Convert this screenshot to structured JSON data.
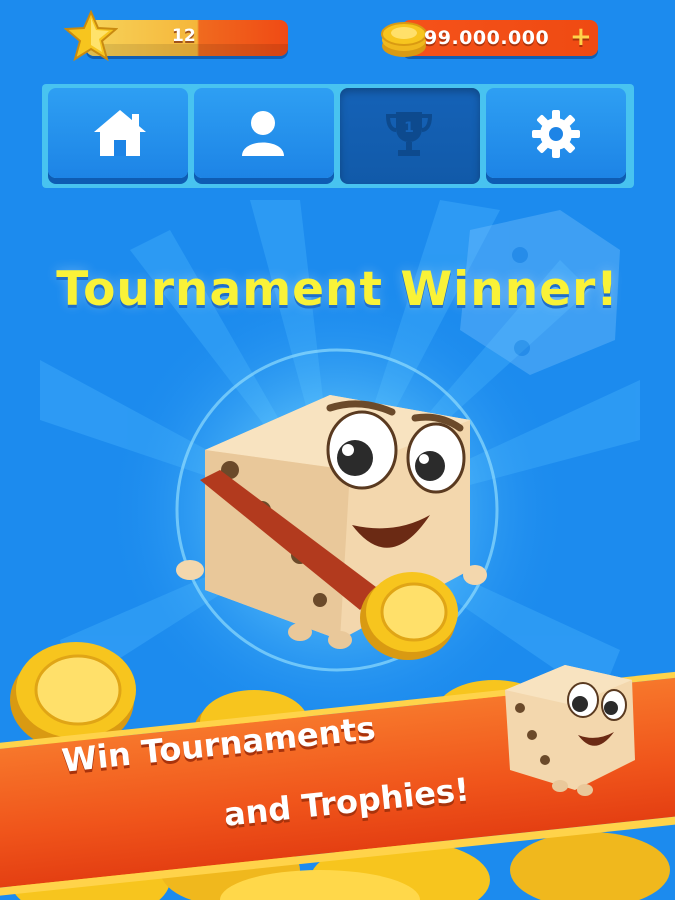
{
  "top_bar": {
    "level": "12",
    "coins": "99.000.000",
    "coins_add": "+"
  },
  "tabs": [
    {
      "name": "home",
      "icon": "home-icon",
      "active": false
    },
    {
      "name": "profile",
      "icon": "user-icon",
      "active": false
    },
    {
      "name": "tournament",
      "icon": "trophy-icon",
      "active": true
    },
    {
      "name": "settings",
      "icon": "gear-icon",
      "active": false
    }
  ],
  "main": {
    "title": "Tournament Winner!",
    "trophy_number": "1"
  },
  "banner": {
    "line1": "Win Tournaments",
    "line2": "and Trophies!"
  },
  "colors": {
    "background": "#1e8ef0",
    "title": "#f9f238",
    "banner": "#f0551b",
    "coin": "#f7c51e"
  }
}
